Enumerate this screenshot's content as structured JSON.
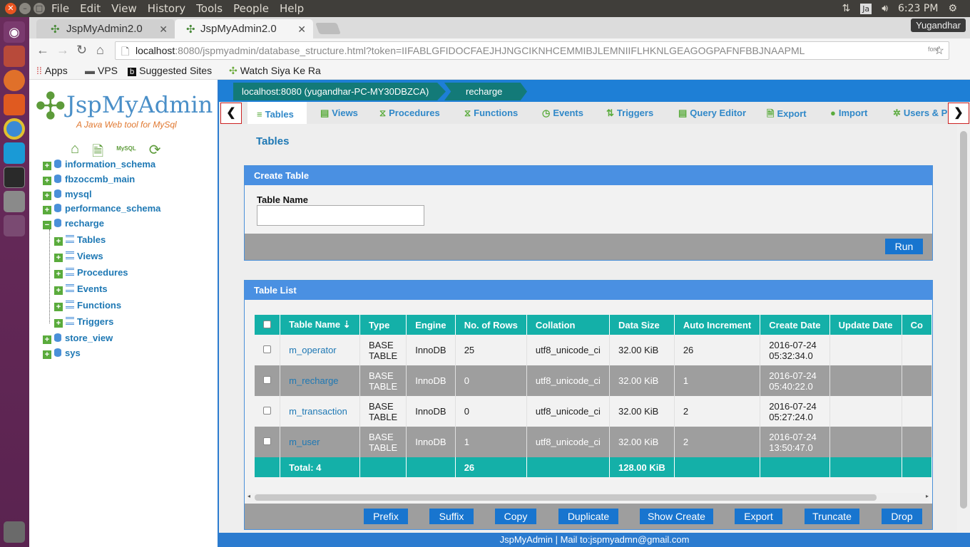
{
  "os": {
    "menu": [
      "File",
      "Edit",
      "View",
      "History",
      "Tools",
      "People",
      "Help"
    ],
    "tray": {
      "clock": "6:23 PM",
      "kbd": "Ja"
    }
  },
  "browser": {
    "tabs": [
      {
        "title": "JspMyAdmin2.0"
      },
      {
        "title": "JspMyAdmin2.0"
      }
    ],
    "user": "Yugandhar",
    "url_host": "localhost",
    "url_rest": ":8080/jspmyadmin/database_structure.html?token=IIFABLGFIDOCFAEJHJNGCIKNHCEMMIBJLEMNIIFLHKNLGEAGOGPAFNFBBJNAAPML",
    "font_ext": "font",
    "bookmarks": [
      "Apps",
      "VPS",
      "Suggested Sites",
      "Watch Siya Ke Ra"
    ]
  },
  "sidebar": {
    "logo_title": "JspMyAdmin",
    "logo_sub": "A Java Web tool for MySql",
    "mysql_icon": "MySQL",
    "databases": [
      "information_schema",
      "fbzoccmb_main",
      "mysql",
      "performance_schema",
      "recharge",
      "store_view",
      "sys"
    ],
    "children": [
      "Tables",
      "Views",
      "Procedures",
      "Events",
      "Functions",
      "Triggers"
    ]
  },
  "breadcrumb": [
    "localhost:8080 (yugandhar-PC-MY30DBZCA)",
    "recharge"
  ],
  "tabs": [
    "Tables",
    "Views",
    "Procedures",
    "Functions",
    "Events",
    "Triggers",
    "Query Editor",
    "Export",
    "Import",
    "Users & P"
  ],
  "page_title": "Tables",
  "create": {
    "header": "Create Table",
    "label": "Table Name",
    "value": "",
    "run": "Run"
  },
  "list": {
    "header": "Table List",
    "columns": [
      "Table Name",
      "Type",
      "Engine",
      "No. of Rows",
      "Collation",
      "Data Size",
      "Auto Increment",
      "Create Date",
      "Update Date",
      "Co"
    ],
    "rows": [
      {
        "name": "m_operator",
        "type1": "BASE",
        "type2": "TABLE",
        "engine": "InnoDB",
        "rows": "25",
        "collation": "utf8_unicode_ci",
        "size": "32.00 KiB",
        "ai": "26",
        "d1": "2016-07-24",
        "d2": "05:32:34.0"
      },
      {
        "name": "m_recharge",
        "type1": "BASE",
        "type2": "TABLE",
        "engine": "InnoDB",
        "rows": "0",
        "collation": "utf8_unicode_ci",
        "size": "32.00 KiB",
        "ai": "1",
        "d1": "2016-07-24",
        "d2": "05:40:22.0"
      },
      {
        "name": "m_transaction",
        "type1": "BASE",
        "type2": "TABLE",
        "engine": "InnoDB",
        "rows": "0",
        "collation": "utf8_unicode_ci",
        "size": "32.00 KiB",
        "ai": "2",
        "d1": "2016-07-24",
        "d2": "05:27:24.0"
      },
      {
        "name": "m_user",
        "type1": "BASE",
        "type2": "TABLE",
        "engine": "InnoDB",
        "rows": "1",
        "collation": "utf8_unicode_ci",
        "size": "32.00 KiB",
        "ai": "2",
        "d1": "2016-07-24",
        "d2": "13:50:47.0"
      }
    ],
    "total": {
      "label": "Total: 4",
      "rows": "26",
      "size": "128.00 KiB"
    },
    "buttons": [
      "Prefix",
      "Suffix",
      "Copy",
      "Duplicate",
      "Show Create",
      "Export",
      "Truncate",
      "Drop"
    ]
  },
  "footer": "JspMyAdmin | Mail to:jspmyadmn@gmail.com",
  "colors": {
    "accent": "#1e7fd6",
    "teal": "#14b0a8",
    "green": "#5aab3c"
  }
}
